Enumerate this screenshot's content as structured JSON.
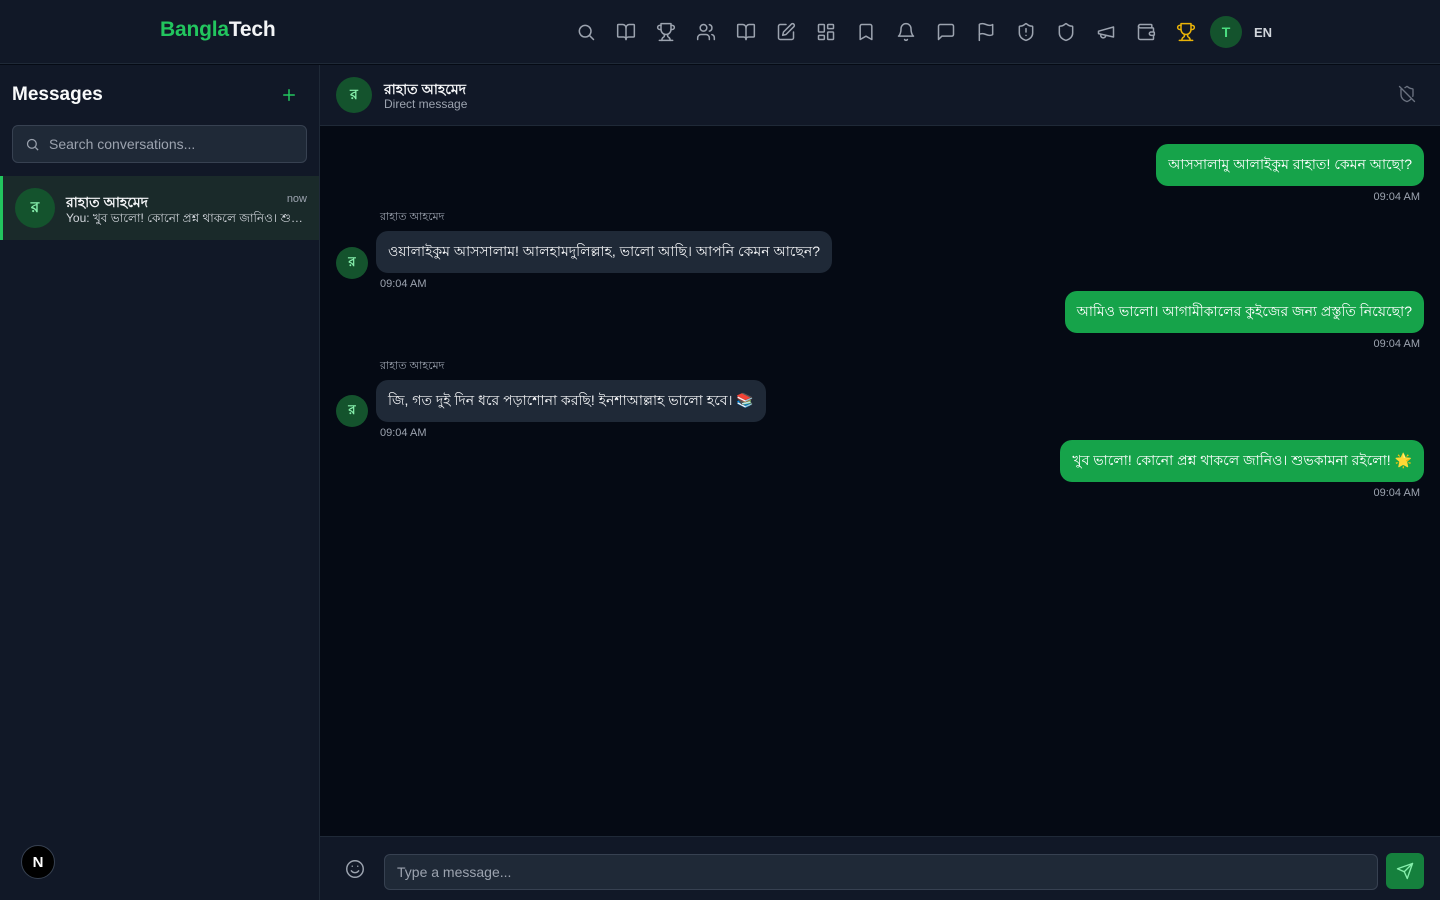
{
  "brand": {
    "part1": "Bangla",
    "part2": "Tech"
  },
  "nav": {
    "icons": [
      "search-icon",
      "book-open-icon",
      "trophy-icon",
      "users-icon",
      "book-icon",
      "edit-icon",
      "grid-icon",
      "bookmark-icon",
      "bell-icon",
      "message-icon",
      "flag-icon",
      "shield-alert-icon",
      "shield-icon",
      "megaphone-icon",
      "wallet-icon",
      "trophy-gold-icon"
    ],
    "avatar_initial": "T",
    "language": "EN"
  },
  "sidebar": {
    "title": "Messages",
    "search_placeholder": "Search conversations...",
    "conversations": [
      {
        "initial": "র",
        "name": "রাহাত আহমেদ",
        "time": "now",
        "preview": "You: খুব ভালো! কোনো প্রশ্ন থাকলে জানিও। শুভকামনা রইলো! 🌟"
      }
    ],
    "badge": "N"
  },
  "chat": {
    "header": {
      "initial": "র",
      "name": "রাহাত আহমেদ",
      "subtitle": "Direct message"
    },
    "messages": [
      {
        "dir": "out",
        "text": "আসসালামু আলাইকুম রাহাত! কেমন আছো?",
        "time": "09:04 AM"
      },
      {
        "dir": "in",
        "sender": "রাহাত আহমেদ",
        "initial": "র",
        "text": "ওয়ালাইকুম আসসালাম! আলহামদুলিল্লাহ, ভালো আছি। আপনি কেমন আছেন?",
        "time": "09:04 AM"
      },
      {
        "dir": "out",
        "text": "আমিও ভালো। আগামীকালের কুইজের জন্য প্রস্তুতি নিয়েছো?",
        "time": "09:04 AM"
      },
      {
        "dir": "in",
        "sender": "রাহাত আহমেদ",
        "initial": "র",
        "text": "জি, গত দুই দিন ধরে পড়াশোনা করছি! ইনশাআল্লাহ ভালো হবে। 📚",
        "time": "09:04 AM"
      },
      {
        "dir": "out",
        "text": "খুব ভালো! কোনো প্রশ্ন থাকলে জানিও। শুভকামনা রইলো! 🌟",
        "time": "09:04 AM"
      }
    ],
    "composer_placeholder": "Type a message..."
  },
  "colors": {
    "accent": "#22c55e",
    "bubble_out": "#16a34a",
    "bubble_in": "#1f2937",
    "trophy": "#eab308"
  }
}
